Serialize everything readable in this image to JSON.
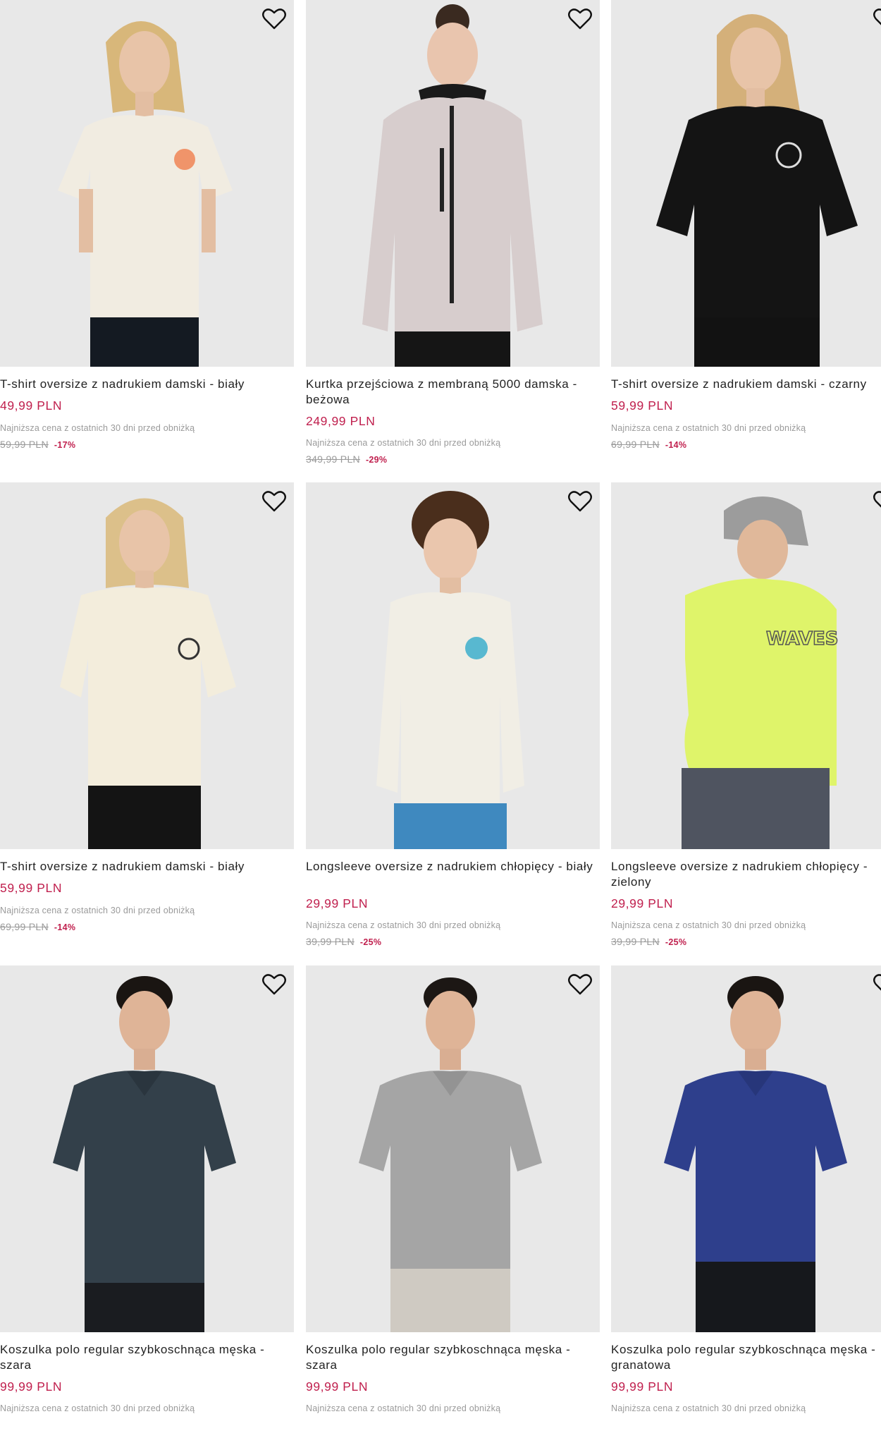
{
  "products": [
    {
      "title": "T-shirt oversize z nadrukiem damski - biały",
      "price": "49,99 PLN",
      "lowest_label": "Najniższa cena z ostatnich 30 dni przed obniżką",
      "old_price": "59,99 PLN",
      "discount": "-17%",
      "garment_color": "#f1ece1",
      "print_color": "#f0946a"
    },
    {
      "title": "Kurtka przejściowa z membraną 5000 damska - beżowa",
      "price": "249,99 PLN",
      "lowest_label": "Najniższa cena z ostatnich 30 dni przed obniżką",
      "old_price": "349,99 PLN",
      "discount": "-29%",
      "garment_color": "#d7cdcd",
      "print_color": "#222222"
    },
    {
      "title": "T-shirt oversize z nadrukiem damski - czarny",
      "price": "59,99 PLN",
      "lowest_label": "Najniższa cena z ostatnich 30 dni przed obniżką",
      "old_price": "69,99 PLN",
      "discount": "-14%",
      "garment_color": "#141414",
      "print_color": "#dddddd"
    },
    {
      "title": "T-shirt oversize z nadrukiem damski - biały",
      "price": "59,99 PLN",
      "lowest_label": "Najniższa cena z ostatnich 30 dni przed obniżką",
      "old_price": "69,99 PLN",
      "discount": "-14%",
      "garment_color": "#f3eddc",
      "print_color": "#333333"
    },
    {
      "title": "Longsleeve oversize z nadrukiem chłopięcy - biały",
      "price": "29,99 PLN",
      "lowest_label": "Najniższa cena z ostatnich 30 dni przed obniżką",
      "old_price": "39,99 PLN",
      "discount": "-25%",
      "garment_color": "#f1eee5",
      "print_color": "#58b8d0"
    },
    {
      "title": "Longsleeve oversize z nadrukiem chłopięcy - zielony",
      "price": "29,99 PLN",
      "lowest_label": "Najniższa cena z ostatnich 30 dni przed obniżką",
      "old_price": "39,99 PLN",
      "discount": "-25%",
      "garment_color": "#dff46a",
      "print_color": "#555555"
    },
    {
      "title": "Koszulka polo regular szybkoschnąca męska - szara",
      "price": "99,99 PLN",
      "lowest_label": "Najniższa cena z ostatnich 30 dni przed obniżką",
      "old_price": "",
      "discount": "",
      "garment_color": "#33404a",
      "print_color": "#33404a"
    },
    {
      "title": "Koszulka polo regular szybkoschnąca męska - szara",
      "price": "99,99 PLN",
      "lowest_label": "Najniższa cena z ostatnich 30 dni przed obniżką",
      "old_price": "",
      "discount": "",
      "garment_color": "#a5a5a5",
      "print_color": "#a5a5a5"
    },
    {
      "title": "Koszulka polo regular szybkoschnąca męska - granatowa",
      "price": "99,99 PLN",
      "lowest_label": "Najniższa cena z ostatnich 30 dni przed obniżką",
      "old_price": "",
      "discount": "",
      "garment_color": "#2e3f8c",
      "print_color": "#2e3f8c"
    }
  ],
  "icons": {
    "wishlist": "heart-outline-icon"
  },
  "colors": {
    "price": "#c0204e",
    "muted": "#9a9a9a",
    "image_bg": "#e7e7e7"
  }
}
